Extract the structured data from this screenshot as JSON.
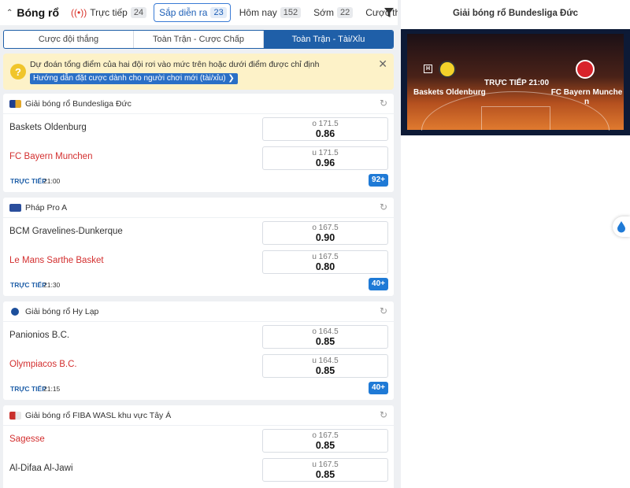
{
  "topbar": {
    "sport": "Bóng rổ",
    "filters": [
      {
        "label": "Trực tiếp",
        "count": "24"
      },
      {
        "label": "Sắp diễn ra",
        "count": "23"
      },
      {
        "label": "Hôm nay",
        "count": "152"
      },
      {
        "label": "Sớm",
        "count": "22"
      },
      {
        "label": "Cược thắng",
        "count": ""
      }
    ]
  },
  "bet_tabs": [
    "Cược đội thắng",
    "Toàn Trận - Cược Chấp",
    "Toàn Trận - Tài/Xỉu"
  ],
  "notice": {
    "text": "Dự đoán tổng điểm của hai đội rơi vào mức trên hoặc dưới điểm được chỉ định",
    "guide_link": "Hướng dẫn đặt cược dành cho người chơi mới (tài/xỉu) ❯"
  },
  "leagues": [
    {
      "name": "Giải bóng rổ Bundesliga Đức",
      "rows": [
        {
          "team": "Baskets Oldenburg",
          "line": "o 171.5",
          "price": "0.86"
        },
        {
          "team": "FC Bayern Munchen",
          "line": "u 171.5",
          "price": "0.96"
        }
      ],
      "live_label": "TRỰC TIẾP",
      "time": "21:00",
      "more": "92+"
    },
    {
      "name": "Pháp Pro A",
      "rows": [
        {
          "team": "BCM Gravelines-Dunkerque",
          "line": "o 167.5",
          "price": "0.90"
        },
        {
          "team": "Le Mans Sarthe Basket",
          "line": "u 167.5",
          "price": "0.80"
        }
      ],
      "live_label": "TRỰC TIẾP",
      "time": "21:30",
      "more": "40+"
    },
    {
      "name": "Giải bóng rổ Hy Lạp",
      "rows": [
        {
          "team": "Panionios B.C.",
          "line": "o 164.5",
          "price": "0.85"
        },
        {
          "team": "Olympiacos B.C.",
          "line": "u 164.5",
          "price": "0.85"
        }
      ],
      "live_label": "TRỰC TIẾP",
      "time": "21:15",
      "more": "40+"
    },
    {
      "name": "Giải bóng rổ FIBA WASL khu vực Tây Á",
      "rows": [
        {
          "team": "Sagesse",
          "line": "o 167.5",
          "price": "0.85"
        },
        {
          "team": "Al-Difaa Al-Jawi",
          "line": "u 167.5",
          "price": "0.85"
        }
      ]
    }
  ],
  "right_panel": {
    "title": "Giải bóng rổ Bundesliga Đức",
    "home_badge": "H",
    "home_team": "Baskets Oldenburg",
    "away_team": "FC Bayern Munche n",
    "status": "TRỰC TIẾP 21:00"
  },
  "colors": {
    "primary": "#1f5fa8",
    "live_red": "#d9342b",
    "team_red": "#d32f2f",
    "notice_bg": "#fdf2c8"
  }
}
